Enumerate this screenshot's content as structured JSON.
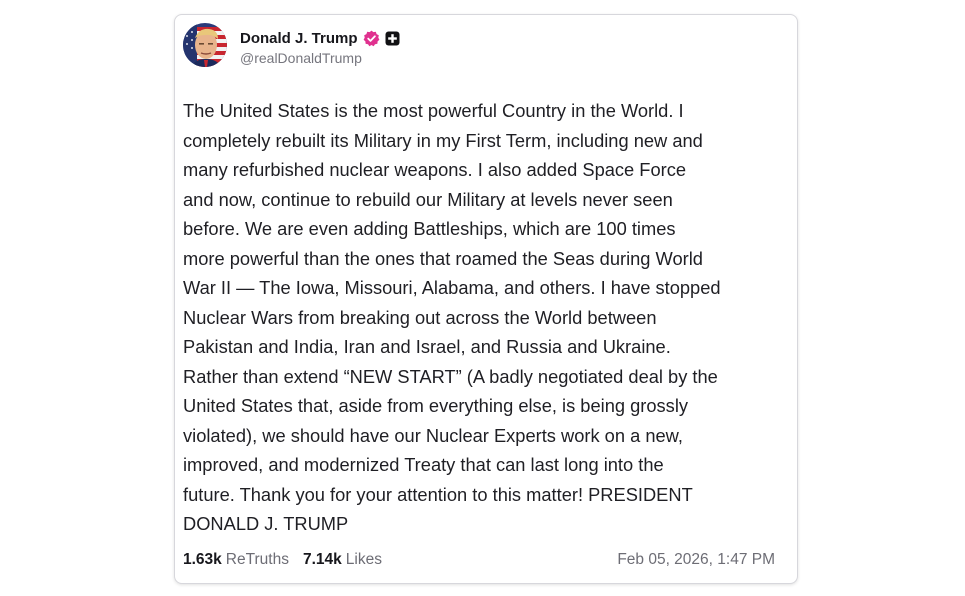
{
  "post": {
    "author": {
      "display_name": "Donald J. Trump",
      "handle": "@realDonaldTrump",
      "avatar_icon": "avatar-portrait-flag",
      "badges": [
        "verified-check-icon",
        "truth-social-badge-icon"
      ],
      "verified_color": "#e0318f"
    },
    "body_lines": [
      "The United States is the most powerful Country in the World. I",
      "completely rebuilt its Military in my First Term, including new and",
      "many refurbished nuclear weapons. I also added Space Force",
      "and now, continue to rebuild our Military at levels never seen",
      "before. We are even adding Battleships, which are 100 times",
      "more powerful than the ones that roamed the Seas during World",
      "War II — The Iowa, Missouri, Alabama, and others. I have stopped",
      "Nuclear Wars from breaking out across the World between",
      "Pakistan and India, Iran and Israel, and Russia and Ukraine.",
      "Rather than extend “NEW START” (A badly negotiated deal by the",
      "United States that, aside from everything else, is being grossly",
      "violated), we should have our Nuclear Experts work on a new,",
      "improved, and modernized Treaty that can last long into the",
      "future. Thank you for your attention to this matter! PRESIDENT",
      "DONALD J. TRUMP"
    ],
    "stats": {
      "retruths_count": "1.63k",
      "retruths_label": "ReTruths",
      "likes_count": "7.14k",
      "likes_label": "Likes"
    },
    "timestamp": "Feb 05, 2026, 1:47 PM"
  }
}
